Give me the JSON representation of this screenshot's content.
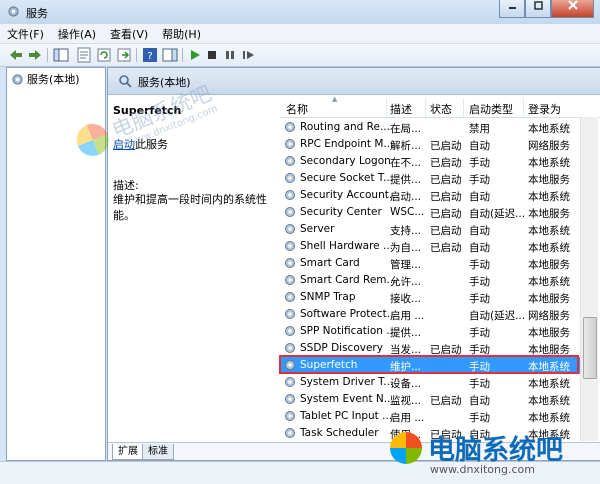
{
  "window": {
    "title": "服务"
  },
  "menu": [
    "文件(F)",
    "操作(A)",
    "查看(V)",
    "帮助(H)"
  ],
  "tree": {
    "root_label": "服务(本地)"
  },
  "pane": {
    "header_title": "服务(本地)",
    "selected_service": "Superfetch",
    "start_link": "启动",
    "start_suffix": "此服务",
    "desc_label": "描述:",
    "desc_text": "维护和提高一段时间内的系统性能。"
  },
  "columns": [
    "名称",
    "描述",
    "状态",
    "启动类型",
    "登录为"
  ],
  "services": [
    {
      "name": "Routing and Re...",
      "desc": "在局...",
      "status": "",
      "startup": "禁用",
      "logon": "本地系统"
    },
    {
      "name": "RPC Endpoint M...",
      "desc": "解析...",
      "status": "已启动",
      "startup": "自动",
      "logon": "网络服务"
    },
    {
      "name": "Secondary Logon",
      "desc": "在不...",
      "status": "已启动",
      "startup": "手动",
      "logon": "本地系统"
    },
    {
      "name": "Secure Socket T...",
      "desc": "提供...",
      "status": "已启动",
      "startup": "手动",
      "logon": "本地服务"
    },
    {
      "name": "Security Account...",
      "desc": "启动...",
      "status": "已启动",
      "startup": "自动",
      "logon": "本地系统"
    },
    {
      "name": "Security Center",
      "desc": "WSC...",
      "status": "已启动",
      "startup": "自动(延迟...",
      "logon": "本地服务"
    },
    {
      "name": "Server",
      "desc": "支持...",
      "status": "已启动",
      "startup": "自动",
      "logon": "本地系统"
    },
    {
      "name": "Shell Hardware ...",
      "desc": "为自...",
      "status": "已启动",
      "startup": "自动",
      "logon": "本地系统"
    },
    {
      "name": "Smart Card",
      "desc": "管理...",
      "status": "",
      "startup": "手动",
      "logon": "本地服务"
    },
    {
      "name": "Smart Card Rem...",
      "desc": "允许...",
      "status": "",
      "startup": "手动",
      "logon": "本地系统"
    },
    {
      "name": "SNMP Trap",
      "desc": "接收...",
      "status": "",
      "startup": "手动",
      "logon": "本地服务"
    },
    {
      "name": "Software Protect...",
      "desc": "启用 ...",
      "status": "",
      "startup": "自动(延迟...",
      "logon": "网络服务"
    },
    {
      "name": "SPP Notification ...",
      "desc": "提供...",
      "status": "",
      "startup": "手动",
      "logon": "本地服务"
    },
    {
      "name": "SSDP Discovery",
      "desc": "当发...",
      "status": "已启动",
      "startup": "手动",
      "logon": "本地服务"
    },
    {
      "name": "Superfetch",
      "desc": "维护...",
      "status": "",
      "startup": "手动",
      "logon": "本地系统"
    },
    {
      "name": "System Driver T...",
      "desc": "设备...",
      "status": "",
      "startup": "手动",
      "logon": "本地系统"
    },
    {
      "name": "System Event N...",
      "desc": "监视...",
      "status": "已启动",
      "startup": "自动",
      "logon": "本地系统"
    },
    {
      "name": "Tablet PC Input ...",
      "desc": "启用 ...",
      "status": "",
      "startup": "手动",
      "logon": "本地系统"
    },
    {
      "name": "Task Scheduler",
      "desc": "使用...",
      "status": "已启动",
      "startup": "自动",
      "logon": "本地系统"
    }
  ],
  "tabs": [
    "扩展",
    "标准"
  ],
  "watermark": {
    "brand": "电脑系统吧",
    "url": "www.dnxitong.com"
  },
  "colors": {
    "selection": "#3399ff",
    "highlight_outline": "#e0303a",
    "link": "#0645ad"
  }
}
